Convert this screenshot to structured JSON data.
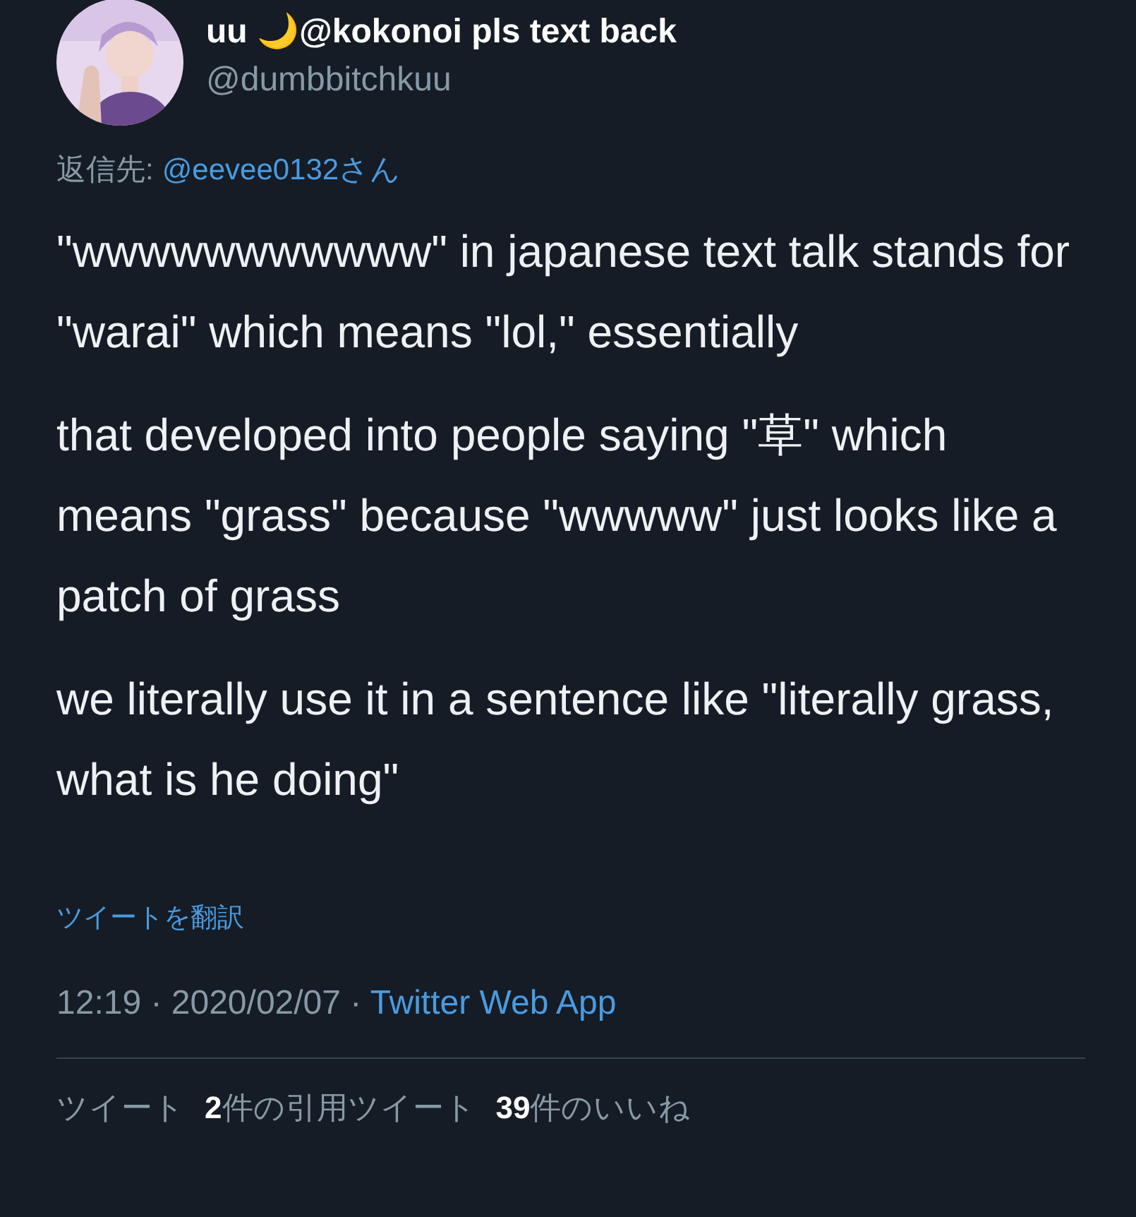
{
  "tweet": {
    "display_name": "uu 🌙@kokonoi pls text back",
    "handle": "@dumbbitchkuu",
    "reply_to": {
      "label": "返信先:",
      "user": "@eevee0132さん"
    },
    "paragraphs": [
      "\"wwwwwwwwwww\" in japanese text talk stands for \"warai\" which means \"lol,\" essentially",
      "that developed into people saying \"草\" which means \"grass\" because \"wwwww\" just looks like a patch of grass",
      "we literally use it in a sentence like \"literally grass, what is he doing\""
    ],
    "translate": "ツイートを翻訳",
    "time": "12:19 · 2020/02/07 · ",
    "source": "Twitter Web App",
    "stats": [
      "ツイート",
      "**2**件の引用ツイート",
      "**39**件のいいね"
    ]
  }
}
